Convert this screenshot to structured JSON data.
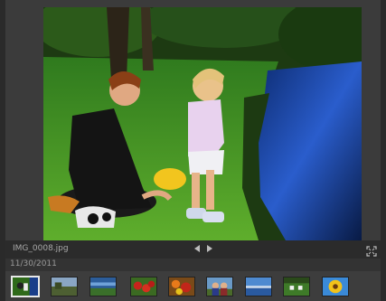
{
  "photo": {
    "filename": "IMG_0008.jpg",
    "date": "11/30/2011"
  },
  "controls": {
    "prev_icon": "triangle-left-icon",
    "next_icon": "triangle-right-icon",
    "fullscreen_icon": "expand-icon"
  },
  "thumbnails": [
    {
      "subject": "mother and child on grass",
      "selected": true
    },
    {
      "subject": "landscape with trees"
    },
    {
      "subject": "blue river scene"
    },
    {
      "subject": "strawberries"
    },
    {
      "subject": "fruit and vegetables"
    },
    {
      "subject": "two people"
    },
    {
      "subject": "sky and water"
    },
    {
      "subject": "garden with white chairs"
    },
    {
      "subject": "sunflower"
    }
  ],
  "colors": {
    "background": "#232323",
    "panel": "#3b3b3b",
    "text": "#a8a8a8"
  }
}
